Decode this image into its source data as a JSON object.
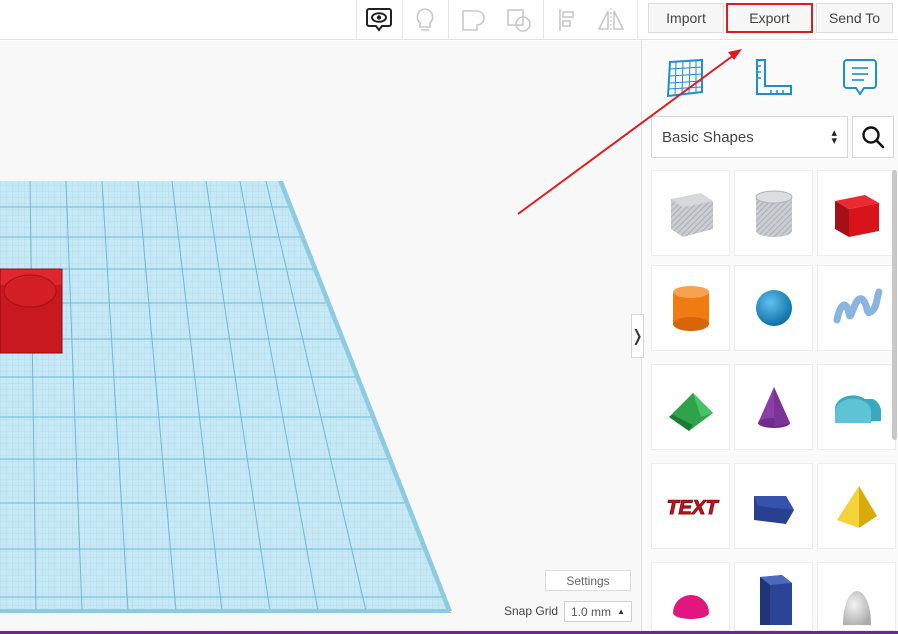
{
  "toolbar": {
    "icons": [
      "eye-speech-icon",
      "lightbulb-icon",
      "group-icon",
      "ungroup-icon",
      "align-icon",
      "mirror-icon"
    ],
    "import_label": "Import",
    "export_label": "Export",
    "send_to_label": "Send To"
  },
  "workplane": {
    "settings_label": "Settings",
    "snap_grid_label": "Snap Grid",
    "snap_grid_value": "1.0 mm",
    "collapse_glyph": "❭"
  },
  "panel": {
    "view_icons": [
      "workplane-icon",
      "ruler-icon",
      "notes-icon"
    ],
    "category": "Basic Shapes",
    "shapes": [
      {
        "name": "box-hole",
        "color": "#b9bcc2"
      },
      {
        "name": "cylinder-hole",
        "color": "#c4c6cb"
      },
      {
        "name": "box",
        "color": "#d8141b"
      },
      {
        "name": "cylinder",
        "color": "#ef7b12"
      },
      {
        "name": "sphere",
        "color": "#1d8fd0"
      },
      {
        "name": "scribble",
        "color": "#8ab4e0"
      },
      {
        "name": "roof",
        "color": "#2ea34a"
      },
      {
        "name": "cone",
        "color": "#8a3fa8"
      },
      {
        "name": "round-roof",
        "color": "#3aa9c0"
      },
      {
        "name": "text",
        "color": "#c0161e"
      },
      {
        "name": "wedge",
        "color": "#27408f"
      },
      {
        "name": "pyramid",
        "color": "#f1c514"
      },
      {
        "name": "half-sphere",
        "color": "#e0177e"
      },
      {
        "name": "polygon",
        "color": "#2a4597"
      },
      {
        "name": "paraboloid",
        "color": "#d9d9d9"
      }
    ]
  },
  "colors": {
    "accent": "#e01b1b",
    "grid_fill": "#bfe3f2",
    "grid_line": "#7fc3dd"
  }
}
